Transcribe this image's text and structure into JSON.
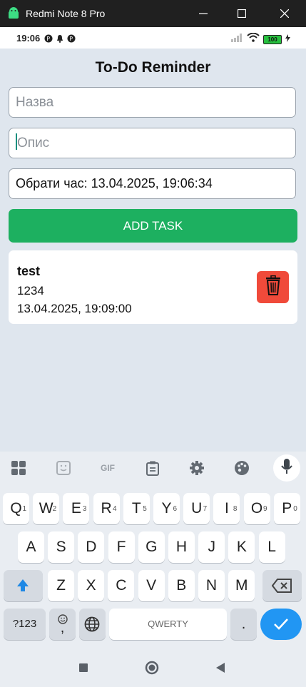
{
  "window": {
    "title": "Redmi Note 8 Pro"
  },
  "status_bar": {
    "time": "19:06",
    "battery": "100"
  },
  "app": {
    "title": "To-Do Reminder",
    "name_placeholder": "Назва",
    "description_placeholder": "Опис",
    "time_label": "Обрати час: 13.04.2025, 19:06:34",
    "add_button": "ADD TASK",
    "tasks": [
      {
        "title": "test",
        "description": "1234",
        "datetime": "13.04.2025, 19:09:00"
      }
    ]
  },
  "keyboard": {
    "toolbar_gif": "GIF",
    "row1": [
      {
        "k": "Q",
        "h": "1"
      },
      {
        "k": "W",
        "h": "2"
      },
      {
        "k": "E",
        "h": "3"
      },
      {
        "k": "R",
        "h": "4"
      },
      {
        "k": "T",
        "h": "5"
      },
      {
        "k": "Y",
        "h": "6"
      },
      {
        "k": "U",
        "h": "7"
      },
      {
        "k": "I",
        "h": "8"
      },
      {
        "k": "O",
        "h": "9"
      },
      {
        "k": "P",
        "h": "0"
      }
    ],
    "row2": [
      "A",
      "S",
      "D",
      "F",
      "G",
      "H",
      "J",
      "K",
      "L"
    ],
    "row3": [
      "Z",
      "X",
      "C",
      "V",
      "B",
      "N",
      "M"
    ],
    "sym_key": "?123",
    "comma": ",",
    "space": "QWERTY",
    "period": "."
  },
  "colors": {
    "accent_green": "#1db060",
    "delete_red": "#f04a3a",
    "enter_blue": "#2196f3"
  }
}
